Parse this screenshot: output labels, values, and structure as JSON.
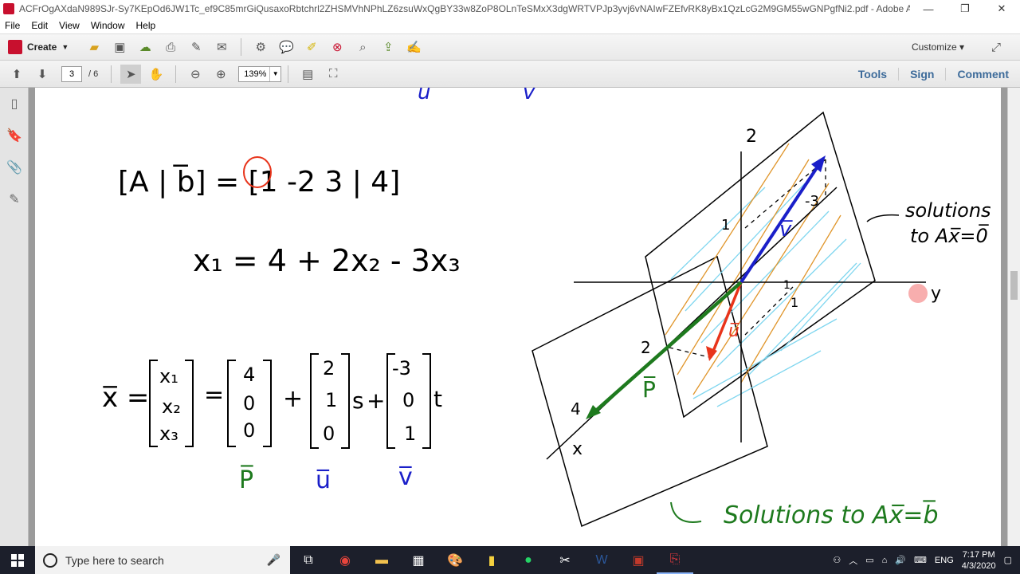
{
  "window": {
    "title": "ACFrOgAXdaN989SJr-Sy7KEpOd6JW1Tc_ef9C85mrGiQusaxoRbtchrl2ZHSMVhNPhLZ6zsuWxQgBY33w8ZoP8OLnTeSMxX3dgWRTVPJp3yvj6vNAIwFZEfvRK8yBx1QzLcG2M9GM55wGNPgfNi2.pdf - Adobe Acrobat Pro",
    "minimize": "—",
    "restore": "❐",
    "close": "✕"
  },
  "menu": [
    "File",
    "Edit",
    "View",
    "Window",
    "Help"
  ],
  "toolbar": {
    "create_label": "Create",
    "customize_label": "Customize"
  },
  "nav": {
    "current_page": "3",
    "total_pages": "/ 6",
    "zoom": "139%"
  },
  "right_tabs": {
    "tools": "Tools",
    "sign": "Sign",
    "comment": "Comment"
  },
  "document": {
    "top_u": "u̅",
    "top_v": "v̅",
    "augmented": "[A | b̅] = [1 -2 3 | 4]",
    "x1_eq": "x₁ = 4 + 2x₂ - 3x₃",
    "x_bar": "x̅ =",
    "x_vec": [
      "x₁",
      "x₂",
      "x₃"
    ],
    "p_vec": [
      "4",
      "0",
      "0"
    ],
    "u_vec": [
      "2",
      "1",
      "0"
    ],
    "v_vec": [
      "-3",
      "0",
      "1"
    ],
    "s_param": "s",
    "t_param": "t",
    "p_label": "P̅",
    "u_label": "u̅",
    "v_label": "v̅",
    "sol_homog_1": "solutions",
    "sol_homog_2": "to Ax̅=0̅",
    "sol_nonhomog": "Solutions to Ax̅=b̅",
    "axis_z": "2",
    "axis_y": "y",
    "axis_x": "x",
    "tick_1a": "1",
    "tick_neg3": "-3",
    "tick_1b": "1",
    "tick_1c": "1",
    "tick_2": "2",
    "tick_4": "4",
    "label_v": "v̅",
    "label_u": "u̅",
    "label_p": "P̅"
  },
  "taskbar": {
    "search_placeholder": "Type here to search",
    "lang": "ENG",
    "time": "7:17 PM",
    "date": "4/3/2020"
  },
  "colors": {
    "blue_ink": "#1a1fc9",
    "green_ink": "#1e7a1e",
    "red_ink": "#e8341b",
    "orange_line": "#e0952a",
    "cyan_line": "#7fd6ef"
  }
}
